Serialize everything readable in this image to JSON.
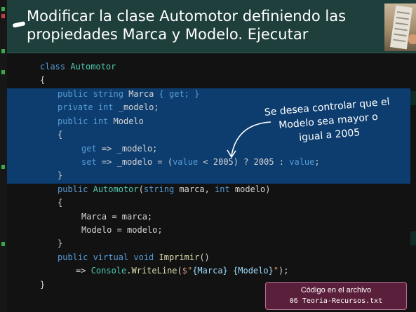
{
  "slide": {
    "title": "Modificar la clase Automotor definiendo las propiedades Marca y Modelo. Ejecutar"
  },
  "annotation": {
    "text": "Se desea controlar que el Modelo sea mayor o igual a 2005"
  },
  "file": {
    "label": "Código en el archivo",
    "name": "06 Teoria-Recursos.txt"
  },
  "code": {
    "class_kw": "class",
    "class_name": "Automotor",
    "open_brace": "{",
    "close_brace": "}",
    "marca_public": "public",
    "marca_type": "string",
    "marca_name": "Marca",
    "marca_get": "{ get; }",
    "field_private": "private",
    "field_type": "int",
    "field_name": "_modelo;",
    "modelo_public": "public",
    "modelo_type": "int",
    "modelo_name": "Modelo",
    "get_kw": "get",
    "get_body": "=> _modelo;",
    "set_kw": "set",
    "set_mid": "=> _modelo = (",
    "set_value1": "value",
    "set_cond": " < 2005) ? 2005 : ",
    "set_value2": "value",
    "set_end": ";",
    "ctor_public": "public",
    "ctor_name": "Automotor",
    "ctor_params_open": "(",
    "ctor_param1_type": "string",
    "ctor_param1_name": " marca, ",
    "ctor_param2_type": "int",
    "ctor_param2_name": " modelo)",
    "assign_marca": "Marca = marca;",
    "assign_modelo": "Modelo = modelo;",
    "imprimir_mods": "public virtual void",
    "imprimir_name": " Imprimir",
    "imprimir_parens": "()",
    "arrow": "=> ",
    "console": "Console",
    "writeline": ".WriteLine",
    "wl_open": "(",
    "str_a": "$\"",
    "interp_a": "{Marca}",
    "str_mid": " ",
    "interp_b": "{Modelo}",
    "str_b": "\"",
    "wl_close": ");"
  },
  "colors": {
    "header_bg": "#1f3f3c",
    "highlight_bg": "#0d3d6e",
    "file_box_bg": "#5a1f3a",
    "keyword": "#569cd6",
    "type_name": "#4ec9b0",
    "method": "#dcdcaa",
    "string": "#ce9178"
  },
  "icons": {
    "photo": "keyboard-photo",
    "arrow": "curved-arrow-icon"
  }
}
